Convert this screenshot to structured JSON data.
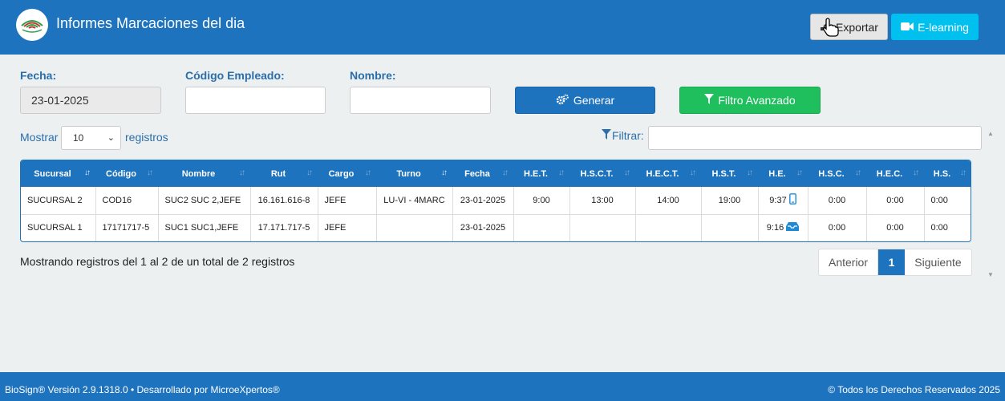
{
  "header": {
    "title": "Informes Marcaciones del dia",
    "export_label": "Exportar",
    "elearning_label": "E-learning"
  },
  "form": {
    "fecha_label": "Fecha:",
    "fecha_value": "23-01-2025",
    "codigo_label": "Código Empleado:",
    "codigo_value": "",
    "nombre_label": "Nombre:",
    "nombre_value": "",
    "generar_label": "Generar",
    "filtro_label": "Filtro Avanzado"
  },
  "table_controls": {
    "mostrar_label": "Mostrar",
    "page_size": "10",
    "registros_label": "registros",
    "filtrar_label": "Filtrar:",
    "filtrar_value": ""
  },
  "table": {
    "columns": [
      "Sucursal",
      "Código",
      "Nombre",
      "Rut",
      "Cargo",
      "Turno",
      "Fecha",
      "H.E.T.",
      "H.S.C.T.",
      "H.E.C.T.",
      "H.S.T.",
      "H.E.",
      "H.S.C.",
      "H.E.C.",
      "H.S."
    ],
    "rows": [
      {
        "sucursal": "SUCURSAL 2",
        "codigo": "COD16",
        "nombre": "SUC2 SUC 2,JEFE",
        "rut": "16.161.616-8",
        "cargo": "JEFE",
        "turno": "LU-VI - 4MARC",
        "fecha": "23-01-2025",
        "het": "9:00",
        "hsct": "13:00",
        "hect": "14:00",
        "hst": "19:00",
        "he": "9:37",
        "he_icon": "mobile-icon",
        "hsc": "0:00",
        "hec": "0:00",
        "hs": "0:00"
      },
      {
        "sucursal": "SUCURSAL 1",
        "codigo": "17171717-5",
        "nombre": "SUC1 SUC1,JEFE",
        "rut": "17.171.717-5",
        "cargo": "JEFE",
        "turno": "",
        "fecha": "23-01-2025",
        "het": "",
        "hsct": "",
        "hect": "",
        "hst": "",
        "he": "9:16",
        "he_icon": "tray-icon",
        "hsc": "0:00",
        "hec": "0:00",
        "hs": "0:00"
      }
    ]
  },
  "footer_info": "Mostrando registros del 1 al 2 de un total de 2 registros",
  "pagination": {
    "prev": "Anterior",
    "current": "1",
    "next": "Siguiente"
  },
  "footer": {
    "left": "BioSign® Versión 2.9.1318.0 • Desarrollado por MicroeXpertos®",
    "right": "© Todos los Derechos Reservados 2025"
  },
  "colors": {
    "primary": "#1e73be",
    "success": "#1fbf5e",
    "info": "#00c0ef",
    "background": "#ecf0f1"
  }
}
